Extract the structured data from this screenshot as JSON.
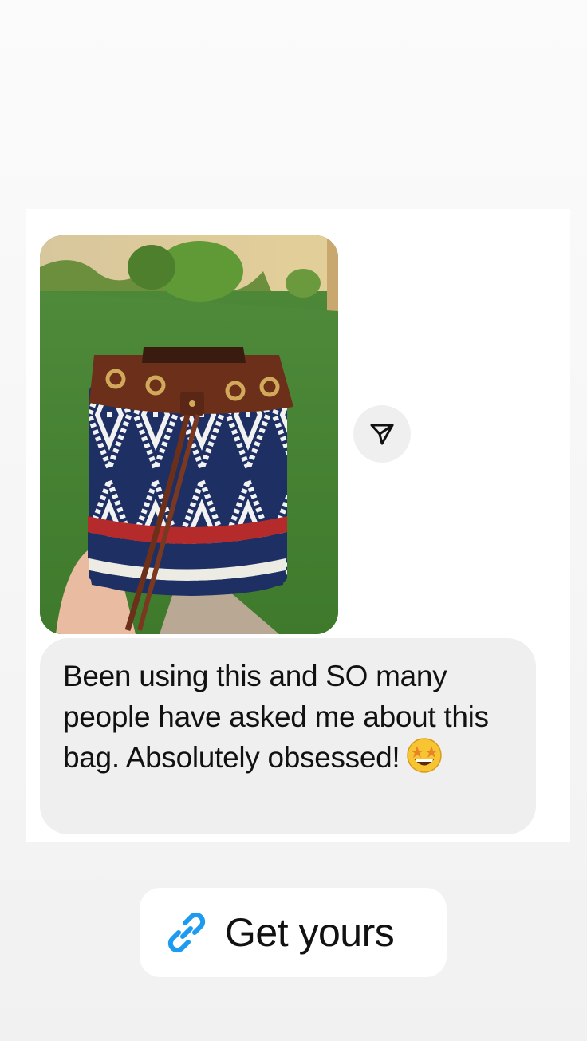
{
  "message": {
    "text": "Been using this and SO many people have asked me about this bag. Absolutely obsessed!",
    "emoji": "star-struck-emoji"
  },
  "photo": {
    "subject": "drawstring-bucket-bag-photo"
  },
  "share": {
    "icon": "send-icon"
  },
  "link_sticker": {
    "label": "Get yours",
    "icon": "link-icon",
    "icon_color": "#1d9bf0"
  }
}
